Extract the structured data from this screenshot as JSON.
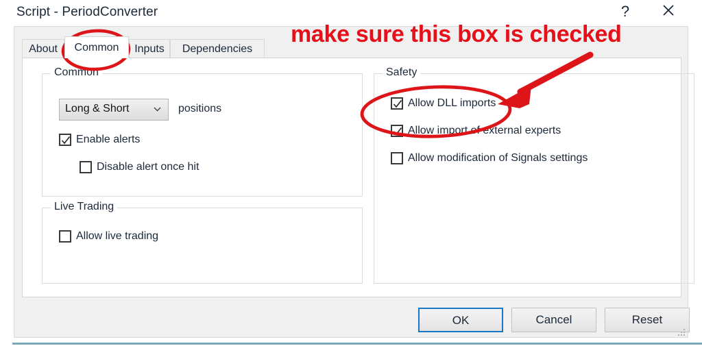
{
  "window": {
    "title": "Script - PeriodConverter",
    "help_button": "?",
    "close_button": "✕"
  },
  "tabs": [
    {
      "label": "About",
      "selected": false
    },
    {
      "label": "Common",
      "selected": true
    },
    {
      "label": "Inputs",
      "selected": false
    },
    {
      "label": "Dependencies",
      "selected": false
    }
  ],
  "groups": {
    "common": {
      "legend": "Common",
      "positions_select": {
        "value": "Long & Short",
        "suffix_label": "positions"
      },
      "checkboxes": [
        {
          "label": "Enable alerts",
          "checked": true
        },
        {
          "label": "Disable alert once hit",
          "checked": false
        }
      ]
    },
    "live_trading": {
      "legend": "Live Trading",
      "checkboxes": [
        {
          "label": "Allow live trading",
          "checked": false
        }
      ]
    },
    "safety": {
      "legend": "Safety",
      "checkboxes": [
        {
          "label": "Allow DLL imports",
          "checked": true
        },
        {
          "label": "Allow import of external experts",
          "checked": true
        },
        {
          "label": "Allow modification of Signals settings",
          "checked": false
        }
      ]
    }
  },
  "footer": {
    "ok": "OK",
    "cancel": "Cancel",
    "reset": "Reset"
  },
  "annotation": {
    "text": "make sure this box is checked",
    "color": "#e51019"
  },
  "colors": {
    "accent_focus": "#1878c8",
    "annotation_red": "#e51019",
    "dialog_background": "#f0f0f0",
    "page_background": "#ffffff",
    "text": "#1b2838"
  }
}
